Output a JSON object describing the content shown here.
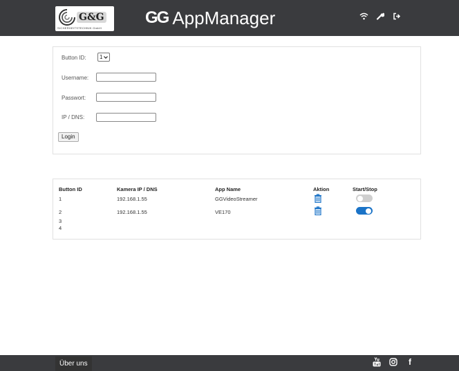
{
  "header": {
    "logo_text": "G&G",
    "logo_sub": "SICHERHEITSTECHNIK GmbH",
    "title_mark": "GG",
    "title": "AppManager",
    "icons": [
      "wifi-icon",
      "wrench-icon",
      "logout-icon"
    ]
  },
  "login": {
    "button_id_label": "Button ID:",
    "button_id_value": "1",
    "username_label": "Username:",
    "username_value": "",
    "password_label": "Passwort:",
    "password_value": "",
    "ip_label": "IP / DNS:",
    "ip_value": "",
    "login_button": "Login"
  },
  "table": {
    "columns": [
      "Button ID",
      "Kamera IP / DNS",
      "App Name",
      "Aktion",
      "Start/Stop"
    ],
    "rows": [
      {
        "id": "1",
        "ip": "192.168.1.55",
        "app": "GGVideoStreamer",
        "has_action": true,
        "running": false
      },
      {
        "id": "2",
        "ip": "192.168.1.55",
        "app": "VE170",
        "has_action": true,
        "running": true
      },
      {
        "id": "3",
        "ip": "",
        "app": "",
        "has_action": false,
        "running": null
      },
      {
        "id": "4",
        "ip": "",
        "app": "",
        "has_action": false,
        "running": null
      }
    ]
  },
  "footer": {
    "about_label": "Über uns",
    "icons": [
      "youtube-icon",
      "instagram-icon",
      "facebook-icon"
    ],
    "facebook_glyph": "f"
  },
  "colors": {
    "header_bg": "#3a3b3e",
    "accent": "#1a73c7",
    "toggle_off": "#cfcfcf"
  }
}
